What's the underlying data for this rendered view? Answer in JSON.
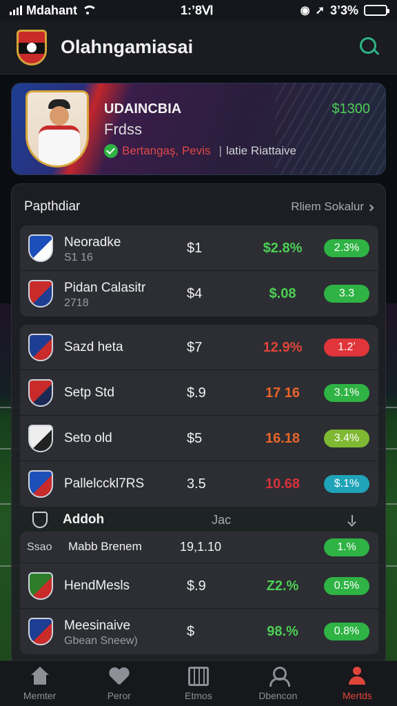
{
  "status_bar": {
    "carrier": "Mdahant",
    "time": "1:ʼ8Ⅵ",
    "battery": "3ʼ3%",
    "battery_level": 0.6
  },
  "header": {
    "title": "Olahngamiasai"
  },
  "featured": {
    "name": "UDAINCBIA",
    "subtitle": "Frdss",
    "status": "Bertangaş, Pevis",
    "separator": "|",
    "note": "latie Riattaive",
    "price": "$1300"
  },
  "panel": {
    "title": "Papthdiar",
    "link": "Rliem Sokalur",
    "group1": [
      {
        "name": "Neoradke",
        "sub": "S1 16",
        "price": "$1",
        "change": "$2.8%",
        "change_color": "#4cd054",
        "pill": "2.3%",
        "pill_color": "#2fb344",
        "crest": [
          "#1d4fb8",
          "#ffffff"
        ]
      },
      {
        "name": "Pidan Calasitr",
        "sub": "2718",
        "price": "$4",
        "change": "$.08",
        "change_color": "#4cd054",
        "pill": "3.3",
        "pill_color": "#2fb344",
        "crest": [
          "#c92a2a",
          "#1d3e93"
        ]
      }
    ],
    "group2": [
      {
        "name": "Sazd heta",
        "price": "$7",
        "change": "12.9%",
        "change_color": "#e0453a",
        "pill": "1.2ʼ",
        "pill_color": "#e0353a",
        "crest": [
          "#1d3e93",
          "#c92a2a"
        ]
      },
      {
        "name": "Setp Std",
        "price": "$.9",
        "change": "17 16",
        "change_color": "#e8652a",
        "pill": "3.1%",
        "pill_color": "#2fb344",
        "crest": [
          "#c92a2a",
          "#1a2a55"
        ]
      },
      {
        "name": "Seto old",
        "price": "$5",
        "change": "16.18",
        "change_color": "#e8652a",
        "pill": "3.4%",
        "pill_color": "#7fb832",
        "crest": [
          "#eeeeee",
          "#222222"
        ]
      },
      {
        "name": "Pallelcckl7RS",
        "price": "3.5",
        "change": "10.68",
        "change_color": "#d6323c",
        "pill": "$.1%",
        "pill_color": "#1fa3b8",
        "crest": [
          "#1d4fb8",
          "#c92a2a"
        ]
      }
    ],
    "section": {
      "name": "Addoh",
      "col": "Jac"
    },
    "mini_row": {
      "label": "Ssao",
      "name": "Mabb Brenem",
      "price": "19,1.10",
      "pill": "1.%",
      "pill_color": "#2fb344"
    },
    "group3": [
      {
        "name": "HendMesls",
        "price": "$.9",
        "change": "Z2.%",
        "change_color": "#4cd054",
        "pill": "0.5%",
        "pill_color": "#2fb344",
        "crest": [
          "#2f7d2a",
          "#c92a2a"
        ]
      },
      {
        "name": "Meesinaive",
        "sub": "Gbean Sneew)",
        "price": "$",
        "change": "98.%",
        "change_color": "#4cd054",
        "pill": "0.8%",
        "pill_color": "#2fb344",
        "crest": [
          "#1d3e93",
          "#c92a2a"
        ]
      }
    ]
  },
  "bottom_nav": [
    {
      "label": "Memter",
      "icon": "home-icon"
    },
    {
      "label": "Peror",
      "icon": "heart-icon"
    },
    {
      "label": "Etmos",
      "icon": "calendar-icon"
    },
    {
      "label": "Dbencon",
      "icon": "person-icon"
    },
    {
      "label": "Mertds",
      "icon": "markets-icon",
      "active": true
    }
  ]
}
